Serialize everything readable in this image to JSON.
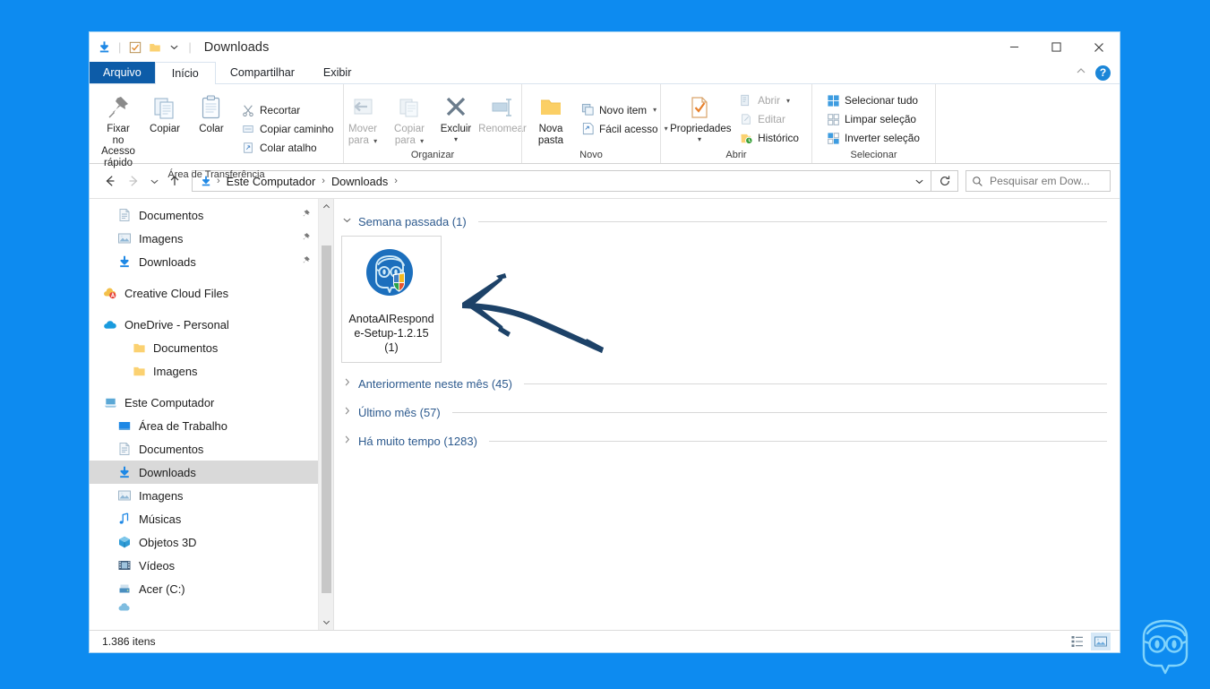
{
  "window": {
    "title": "Downloads",
    "quick_access_icons": [
      "download-icon",
      "checkbox-icon",
      "folder-icon",
      "chevron-down-icon"
    ],
    "controls": {
      "minimize": "—",
      "maximize": "☐",
      "close": "✕"
    }
  },
  "ribbon": {
    "tabs": [
      {
        "label": "Arquivo",
        "state": "file"
      },
      {
        "label": "Início",
        "state": "active"
      },
      {
        "label": "Compartilhar",
        "state": "normal"
      },
      {
        "label": "Exibir",
        "state": "normal"
      }
    ],
    "collapse_icon": "chevron-up-icon",
    "help_label": "?",
    "groups": [
      {
        "label": "Área de Transferência",
        "big": [
          {
            "label": "Fixar no\nAcesso rápido",
            "icon": "pin-icon",
            "disabled": false
          },
          {
            "label": "Copiar",
            "icon": "copy-icon",
            "disabled": false
          },
          {
            "label": "Colar",
            "icon": "paste-icon",
            "disabled": false
          }
        ],
        "small": [
          {
            "label": "Recortar",
            "icon": "scissors-icon",
            "disabled": false
          },
          {
            "label": "Copiar caminho",
            "icon": "copy-path-icon",
            "disabled": false
          },
          {
            "label": "Colar atalho",
            "icon": "paste-shortcut-icon",
            "disabled": false
          }
        ]
      },
      {
        "label": "Organizar",
        "big": [
          {
            "label": "Mover\npara",
            "icon": "move-to-icon",
            "disabled": true,
            "caret": true
          },
          {
            "label": "Copiar\npara",
            "icon": "copy-to-icon",
            "disabled": true,
            "caret": true
          },
          {
            "label": "Excluir",
            "icon": "delete-x-icon",
            "disabled": false,
            "caret": true
          },
          {
            "label": "Renomear",
            "icon": "rename-icon",
            "disabled": true
          }
        ],
        "small": []
      },
      {
        "label": "Novo",
        "big": [
          {
            "label": "Nova\npasta",
            "icon": "new-folder-icon",
            "disabled": false
          }
        ],
        "small": [
          {
            "label": "Novo item",
            "icon": "new-item-icon",
            "disabled": false,
            "caret": true
          },
          {
            "label": "Fácil acesso",
            "icon": "easy-access-icon",
            "disabled": false,
            "caret": true
          }
        ]
      },
      {
        "label": "Abrir",
        "big": [
          {
            "label": "Propriedades",
            "icon": "properties-icon",
            "disabled": false,
            "caret": true
          }
        ],
        "small": [
          {
            "label": "Abrir",
            "icon": "open-icon",
            "disabled": true,
            "caret": true
          },
          {
            "label": "Editar",
            "icon": "edit-icon",
            "disabled": true
          },
          {
            "label": "Histórico",
            "icon": "history-icon",
            "disabled": false
          }
        ]
      },
      {
        "label": "Selecionar",
        "big": [],
        "small": [
          {
            "label": "Selecionar tudo",
            "icon": "select-all-icon",
            "disabled": false
          },
          {
            "label": "Limpar seleção",
            "icon": "select-none-icon",
            "disabled": false
          },
          {
            "label": "Inverter seleção",
            "icon": "invert-selection-icon",
            "disabled": false
          }
        ]
      }
    ]
  },
  "addressbar": {
    "back_icon": "arrow-left-icon",
    "forward_icon": "arrow-right-icon",
    "recent_icon": "chevron-down-icon",
    "up_icon": "arrow-up-icon",
    "breadcrumb_icon": "download-icon",
    "breadcrumbs": [
      "Este Computador",
      "Downloads"
    ],
    "separator": "›",
    "dropdown_icon": "chevron-down-icon",
    "refresh_icon": "refresh-icon",
    "search_placeholder": "Pesquisar em Dow...",
    "search_icon": "search-icon"
  },
  "navpane": {
    "items": [
      {
        "label": "Documentos",
        "icon": "documents-icon",
        "level": 1,
        "pinned": true,
        "selected": false
      },
      {
        "label": "Imagens",
        "icon": "pictures-icon",
        "level": 1,
        "pinned": true,
        "selected": false
      },
      {
        "label": "Downloads",
        "icon": "download-icon",
        "level": 1,
        "pinned": true,
        "selected": false
      },
      {
        "label": "Creative Cloud Files",
        "icon": "creative-cloud-icon",
        "level": 0,
        "pinned": false,
        "selected": false
      },
      {
        "label": "OneDrive - Personal",
        "icon": "onedrive-icon",
        "level": 0,
        "pinned": false,
        "selected": false
      },
      {
        "label": "Documentos",
        "icon": "folder-icon",
        "level": 1,
        "pinned": false,
        "selected": false
      },
      {
        "label": "Imagens",
        "icon": "folder-icon",
        "level": 1,
        "pinned": false,
        "selected": false
      },
      {
        "label": "Este Computador",
        "icon": "this-pc-icon",
        "level": 0,
        "pinned": false,
        "selected": false
      },
      {
        "label": "Área de Trabalho",
        "icon": "desktop-icon",
        "level": 1,
        "pinned": false,
        "selected": false
      },
      {
        "label": "Documentos",
        "icon": "documents-icon",
        "level": 1,
        "pinned": false,
        "selected": false
      },
      {
        "label": "Downloads",
        "icon": "download-icon",
        "level": 1,
        "pinned": false,
        "selected": true
      },
      {
        "label": "Imagens",
        "icon": "pictures-icon",
        "level": 1,
        "pinned": false,
        "selected": false
      },
      {
        "label": "Músicas",
        "icon": "music-icon",
        "level": 1,
        "pinned": false,
        "selected": false
      },
      {
        "label": "Objetos 3D",
        "icon": "objects3d-icon",
        "level": 1,
        "pinned": false,
        "selected": false
      },
      {
        "label": "Vídeos",
        "icon": "videos-icon",
        "level": 1,
        "pinned": false,
        "selected": false
      },
      {
        "label": "Acer (C:)",
        "icon": "drive-icon",
        "level": 1,
        "pinned": false,
        "selected": false
      },
      {
        "label": "",
        "icon": "network-icon",
        "level": 1,
        "pinned": false,
        "selected": false
      }
    ],
    "scroll_up_icon": "chevron-up-icon",
    "scroll_down_icon": "chevron-down-icon"
  },
  "content": {
    "groups": [
      {
        "label": "Semana passada (1)",
        "expanded": true,
        "chevron": "⌄",
        "files": [
          {
            "name": "AnotaAIResponde-Setup-1.2.15 (1)",
            "icon": "anotaai-installer-icon",
            "selected": true
          }
        ]
      },
      {
        "label": "Anteriormente neste mês (45)",
        "expanded": false,
        "chevron": "›",
        "files": []
      },
      {
        "label": "Último mês (57)",
        "expanded": false,
        "chevron": "›",
        "files": []
      },
      {
        "label": "Há muito tempo (1283)",
        "expanded": false,
        "chevron": "›",
        "files": []
      }
    ]
  },
  "statusbar": {
    "item_count": "1.386 itens",
    "views": [
      {
        "name": "details-view-button",
        "active": false
      },
      {
        "name": "large-icons-view-button",
        "active": true
      }
    ]
  },
  "annotation": {
    "type": "hand-drawn-arrow",
    "direction": "left",
    "color": "#1d4268"
  },
  "colors": {
    "desktop_background": "#0d8bf0",
    "file_tab": "#0d5ca8",
    "group_header_text": "#2d5a8e",
    "selection": "#d9d9d9",
    "accent": "#1b86d8"
  }
}
